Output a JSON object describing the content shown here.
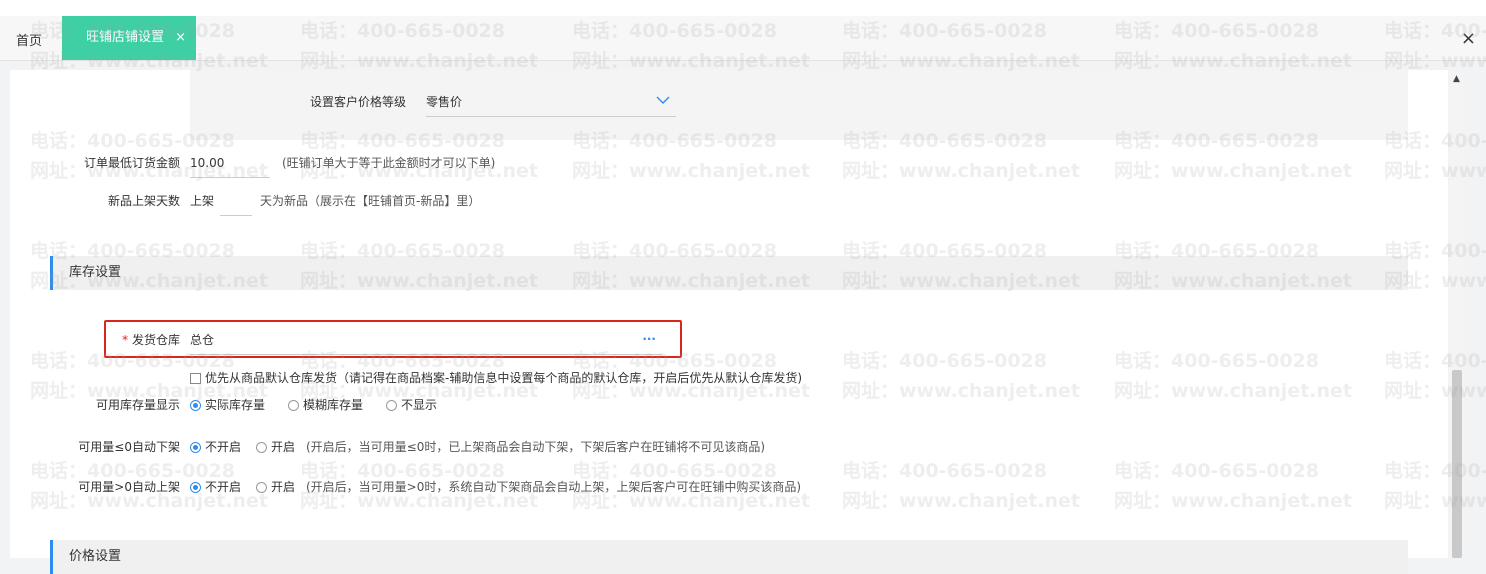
{
  "tabs": {
    "home": "首页",
    "active": "旺铺店铺设置",
    "close": "×"
  },
  "window_close": "×",
  "price_level": {
    "label": "设置客户价格等级",
    "value": "零售价"
  },
  "min_order": {
    "label": "订单最低订货金额",
    "value": "10.00",
    "hint": "(旺铺订单大于等于此金额时才可以下单)"
  },
  "new_days": {
    "label": "新品上架天数",
    "prefix": "上架",
    "suffix": "天为新品（展示在【旺铺首页-新品】里）"
  },
  "stock_section": {
    "title": "库存设置"
  },
  "warehouse": {
    "required_mark": "*",
    "label": "发货仓库",
    "value": "总仓",
    "more": "···"
  },
  "default_warehouse": {
    "text": "优先从商品默认仓库发货（请记得在商品档案-辅助信息中设置每个商品的默认仓库，开启后优先从默认仓库发货)"
  },
  "stock_display": {
    "label": "可用库存量显示",
    "options": [
      "实际库存量",
      "模糊库存量",
      "不显示"
    ],
    "selected": 0
  },
  "auto_off": {
    "label": "可用量≤0自动下架",
    "options": [
      "不开启",
      "开启"
    ],
    "selected": 0,
    "hint": "(开启后，当可用量≤0时，已上架商品会自动下架，下架后客户在旺铺将不可见该商品)"
  },
  "auto_on": {
    "label": "可用量>0自动上架",
    "options": [
      "不开启",
      "开启"
    ],
    "selected": 0,
    "hint": "(开启后，当可用量>0时，系统自动下架商品会自动上架，上架后客户可在旺铺中购买该商品)"
  },
  "price_section": {
    "title": "价格设置"
  },
  "watermark": {
    "phone": "电话：400-665-0028",
    "site": "网址：www.chanjet.net"
  },
  "colors": {
    "accent_tab": "#3ecfa5",
    "section_bar": "#2d8cf0",
    "highlight_box": "#d9261c"
  }
}
